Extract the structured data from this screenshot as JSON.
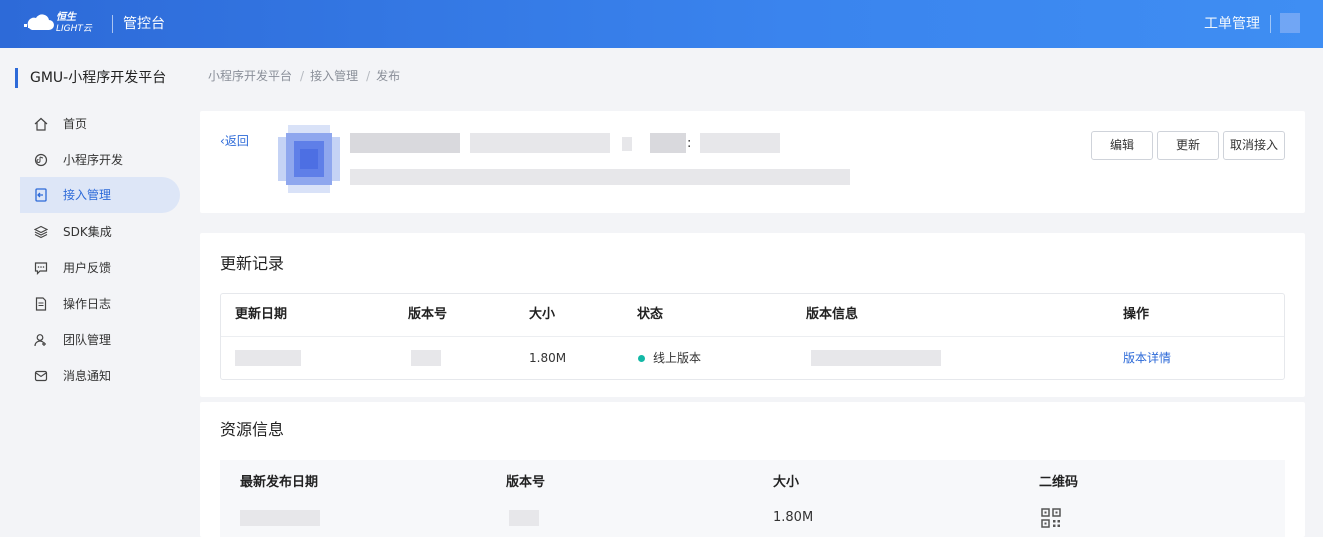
{
  "header": {
    "logo_line1": "恒生",
    "logo_line2": "LIGHT云",
    "console_title": "管控台",
    "ticket_link": "工单管理",
    "brand_color": "#2d6ad8"
  },
  "sidebar": {
    "platform_title": "GMU-小程序开发平台",
    "items": [
      {
        "label": "首页",
        "icon": "home-icon"
      },
      {
        "label": "小程序开发",
        "icon": "code-icon"
      },
      {
        "label": "接入管理",
        "icon": "access-icon",
        "active": true
      },
      {
        "label": "SDK集成",
        "icon": "layers-icon"
      },
      {
        "label": "用户反馈",
        "icon": "feedback-icon"
      },
      {
        "label": "操作日志",
        "icon": "log-icon"
      },
      {
        "label": "团队管理",
        "icon": "team-icon"
      },
      {
        "label": "消息通知",
        "icon": "mail-icon"
      }
    ]
  },
  "breadcrumb": [
    "小程序开发平台",
    "接入管理",
    "发布"
  ],
  "app_card": {
    "back_label": "返回",
    "colon": ":",
    "buttons": {
      "edit": "编辑",
      "update": "更新",
      "cancel": "取消接入"
    }
  },
  "update_records": {
    "title": "更新记录",
    "columns": [
      "更新日期",
      "版本号",
      "大小",
      "状态",
      "版本信息",
      "操作"
    ],
    "rows": [
      {
        "size": "1.80M",
        "status": "线上版本",
        "action": "版本详情"
      }
    ],
    "status_color": "#13b8a6"
  },
  "resource_info": {
    "title": "资源信息",
    "columns": [
      "最新发布日期",
      "版本号",
      "大小",
      "二维码"
    ],
    "row": {
      "size": "1.80M",
      "qr": "qr-code-icon"
    }
  }
}
